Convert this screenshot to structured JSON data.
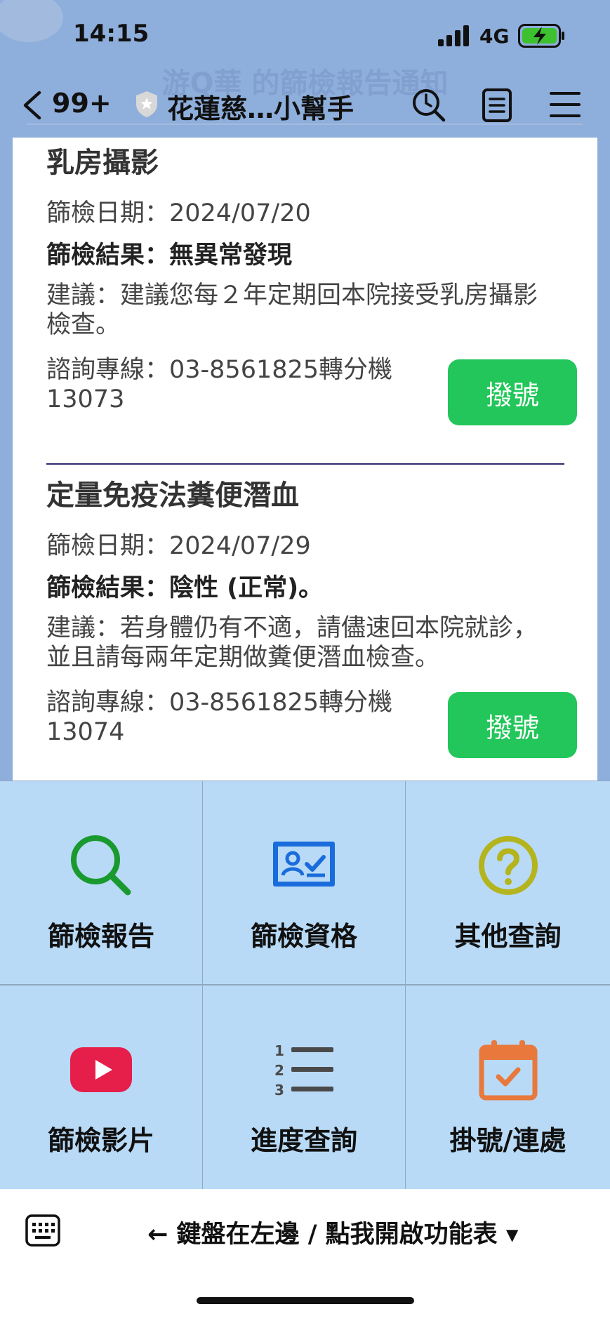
{
  "status_bar": {
    "time": "14:15",
    "network": "4G",
    "battery_color": "#3dc12f"
  },
  "chat": {
    "faded_title": "游Q華 的篩檢報告通知",
    "unread_count": "99+",
    "title": "花蓮慈…小幫手"
  },
  "message": {
    "sections": [
      {
        "title": "乳房攝影",
        "date": "篩檢日期：2024/07/20",
        "result": "篩檢結果：無異常發現",
        "advice": "建議：建議您每２年定期回本院接受乳房攝影檢查。",
        "contact": "諮詢專線：03-8561825轉分機13073",
        "dial_label": "撥號"
      },
      {
        "title": "定量免疫法糞便潛血",
        "date": "篩檢日期：2024/07/29",
        "result": "篩檢結果：陰性 (正常)。",
        "advice": "建議：若身體仍有不適，請儘速回本院就診，並且請每兩年定期做糞便潛血檢查。",
        "contact": "諮詢專線：03-8561825轉分機13074",
        "dial_label": "撥號"
      }
    ],
    "dial_button_color": "#22c65a"
  },
  "rich_menu": {
    "items": [
      {
        "label": "篩檢報告",
        "icon": "search-icon",
        "color": "#1a9a2e"
      },
      {
        "label": "篩檢資格",
        "icon": "id-card-check-icon",
        "color": "#1a6cdc"
      },
      {
        "label": "其他查詢",
        "icon": "question-circle-icon",
        "color": "#b4b41e"
      },
      {
        "label": "篩檢影片",
        "icon": "youtube-play-icon",
        "color": "#e61e4a"
      },
      {
        "label": "進度查詢",
        "icon": "numbered-list-icon",
        "color": "#4a4a4a"
      },
      {
        "label": "掛號/連處",
        "icon": "calendar-check-icon",
        "color": "#e8783c"
      }
    ],
    "background": "#b8daf6"
  },
  "bottom_bar": {
    "toggle_label": "← 鍵盤在左邊 / 點我開啟功能表 ▾"
  }
}
